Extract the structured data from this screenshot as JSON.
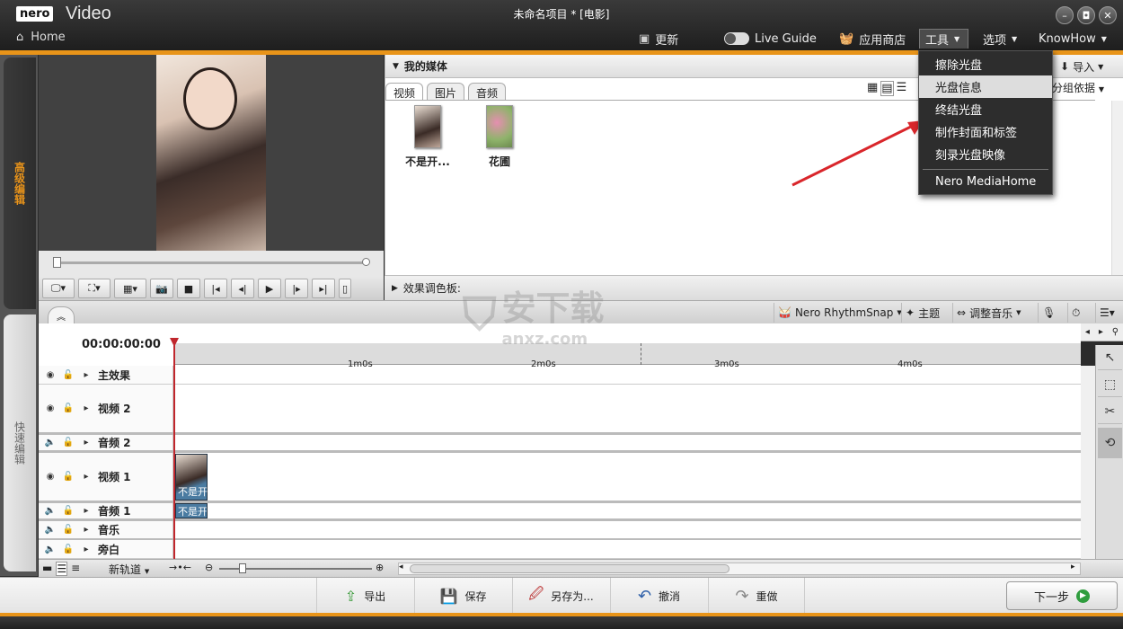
{
  "titlebar": {
    "logo": "nero",
    "app_name": "Video",
    "document_title": "未命名项目 * [电影]",
    "home_label": "Home",
    "win_minimize": "–",
    "win_restore": "◘",
    "win_close": "✕"
  },
  "nav": {
    "update": "更新",
    "live_guide": "Live Guide",
    "app_store": "应用商店",
    "tools": "工具",
    "options": "选项",
    "knowhow": "KnowHow"
  },
  "tools_menu": {
    "items": [
      "擦除光盘",
      "光盘信息",
      "终结光盘",
      "制作封面和标签",
      "刻录光盘映像",
      "Nero MediaHome"
    ],
    "highlighted_index": 1
  },
  "rail": {
    "advanced": "高级编辑",
    "quick": "快速编辑"
  },
  "media": {
    "title": "我的媒体",
    "import_label": "导入",
    "group_label": "分组依据",
    "tabs": [
      "视频",
      "图片",
      "音频"
    ],
    "items": [
      {
        "label": "不是开..."
      },
      {
        "label": "花圃"
      }
    ]
  },
  "effects": {
    "label": "效果调色板:"
  },
  "timeline_toolbar": {
    "rhythmsnap": "Nero RhythmSnap",
    "theme": "主题",
    "adjust_music": "调整音乐"
  },
  "timeline": {
    "timecode": "00:00:00:00",
    "ticks": [
      "1m0s",
      "2m0s",
      "3m0s",
      "4m0s"
    ],
    "tracks": [
      "主效果",
      "视频 2",
      "音频 2",
      "视频 1",
      "音频 1",
      "音乐",
      "旁白"
    ],
    "clip_label": "不是开",
    "new_track": "新轨道"
  },
  "bottom": {
    "export": "导出",
    "save": "保存",
    "save_as": "另存为...",
    "undo": "撤消",
    "redo": "重做",
    "next": "下一步"
  },
  "watermark": {
    "text": "安下载",
    "sub": "anxz.com"
  }
}
